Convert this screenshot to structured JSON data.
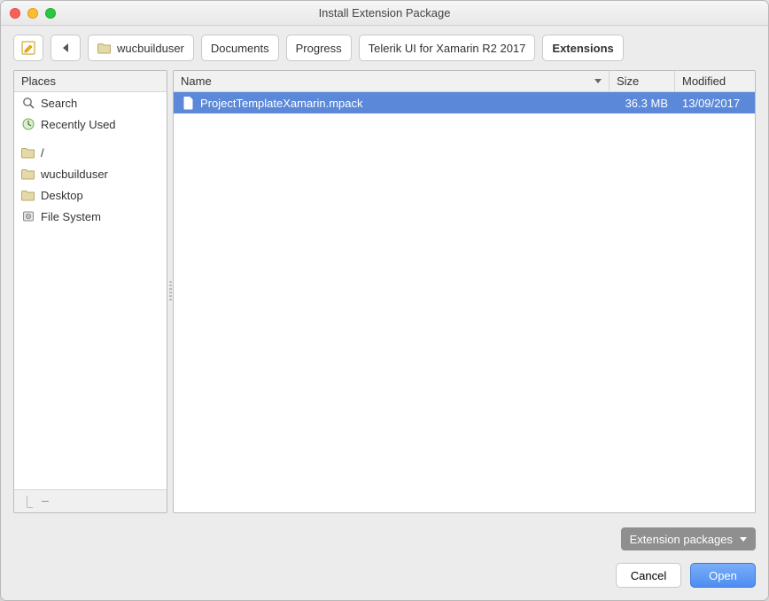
{
  "window": {
    "title": "Install Extension Package"
  },
  "breadcrumb": {
    "items": [
      {
        "label": "wucbuilduser",
        "icon": "folder"
      },
      {
        "label": "Documents"
      },
      {
        "label": "Progress"
      },
      {
        "label": "Telerik UI for Xamarin R2 2017"
      },
      {
        "label": "Extensions",
        "active": true
      }
    ]
  },
  "sidebar": {
    "header": "Places",
    "items": [
      {
        "label": "Search",
        "icon": "search"
      },
      {
        "label": "Recently Used",
        "icon": "recent"
      },
      {
        "label": "/",
        "icon": "folder",
        "gapBefore": true
      },
      {
        "label": "wucbuilduser",
        "icon": "folder"
      },
      {
        "label": "Desktop",
        "icon": "folder"
      },
      {
        "label": "File System",
        "icon": "disk"
      }
    ]
  },
  "columns": {
    "name": "Name",
    "size": "Size",
    "modified": "Modified"
  },
  "files": [
    {
      "name": "ProjectTemplateXamarin.mpack",
      "size": "36.3 MB",
      "modified": "13/09/2017",
      "selected": true
    }
  ],
  "filter": {
    "label": "Extension packages"
  },
  "actions": {
    "cancel": "Cancel",
    "open": "Open"
  }
}
